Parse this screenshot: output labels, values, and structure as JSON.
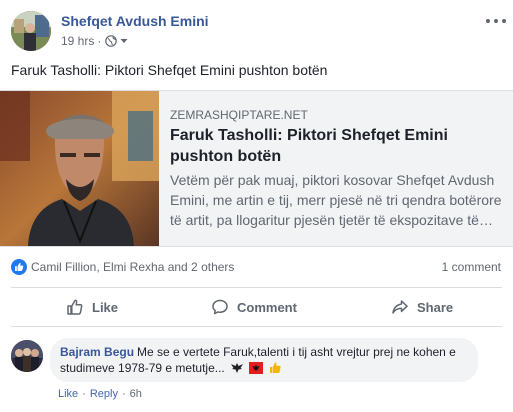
{
  "post": {
    "author": "Shefqet Avdush Emini",
    "time": "19 hrs",
    "dot": "·",
    "text": "Faruk Tasholli: Piktori Shefqet Emini pushton botën",
    "privacy_icon": "globe-icon",
    "more_icon": "more-horizontal-icon"
  },
  "link": {
    "domain": "ZEMRASHQIPTARE.NET",
    "title": "Faruk Tasholli: Piktori Shefqet Emini pushton botën",
    "description": "Vetëm për pak muaj, piktori kosovar Shefqet Avdush Emini, me artin e tij, merr pjesë në tri qendra botërore të artit, pa llogaritur pjesën tjetër të ekspozitave të…"
  },
  "reactions": {
    "icon": "like-reaction-icon",
    "names": "Camil Fillion, Elmi Rexha and 2 others",
    "comment_count": "1 comment"
  },
  "actions": {
    "like": "Like",
    "comment": "Comment",
    "share": "Share"
  },
  "comment": {
    "author": "Bajram Begu",
    "text": "Me se e vertete Faruk,talenti i tij asht vrejtur prej ne kohen e studimeve 1978-79 e metutje...",
    "emojis": [
      "eagle-icon",
      "albania-flag-icon",
      "thumbs-up-icon"
    ],
    "like": "Like",
    "reply": "Reply",
    "dot": "·",
    "time": "6h"
  },
  "colors": {
    "link_blue": "#385898",
    "fb_blue": "#4267b2",
    "meta_gray": "#616770",
    "card_bg": "#f2f3f5",
    "flag_red": "#e41e20"
  }
}
